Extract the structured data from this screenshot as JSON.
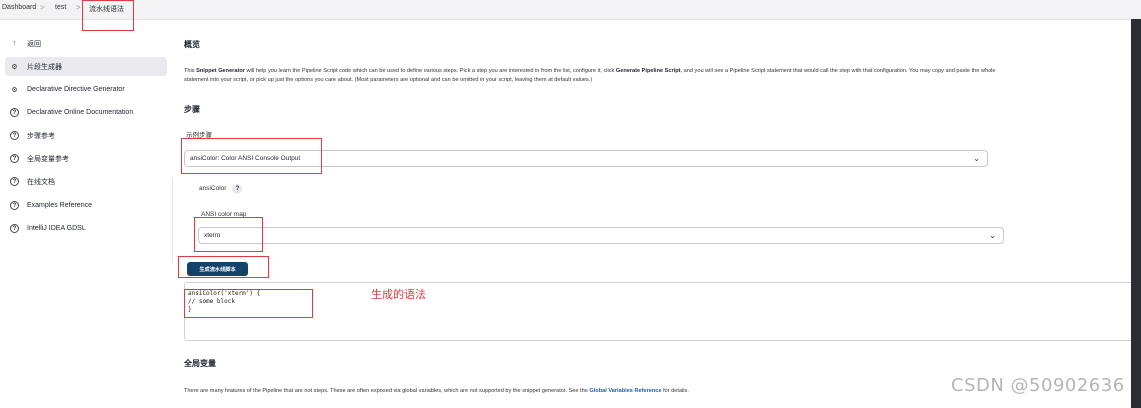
{
  "breadcrumb": {
    "items": [
      "Dashboard",
      "test",
      "流水线语法"
    ],
    "separator": ">"
  },
  "sidebar": {
    "items": [
      {
        "label": "返回",
        "icon": "arrow-up-icon"
      },
      {
        "label": "片段生成器",
        "icon": "gear-icon",
        "active": true
      },
      {
        "label": "Declarative Directive Generator",
        "icon": "gear-icon"
      },
      {
        "label": "Declarative Online Documentation",
        "icon": "help-circle-icon"
      },
      {
        "label": "步骤参考",
        "icon": "help-circle-icon"
      },
      {
        "label": "全局变量参考",
        "icon": "help-circle-icon"
      },
      {
        "label": "在线文档",
        "icon": "help-circle-icon"
      },
      {
        "label": "Examples Reference",
        "icon": "help-circle-icon"
      },
      {
        "label": "IntelliJ IDEA GDSL",
        "icon": "help-circle-icon"
      }
    ]
  },
  "overview": {
    "title": "概览",
    "line1_a": "This ",
    "line1_b": "Snippet Generator",
    "line1_c": " will help you learn the Pipeline Script code which can be used to define various steps. Pick a step you are interested in from the list, configure it, click ",
    "line1_d": "Generate Pipeline Script",
    "line1_e": ", and you will see a Pipeline Script statement that would call the step with that configuration. You may copy and paste the whole",
    "line2": "statement into your script, or pick up just the options you care about. (Most parameters are optional and can be omitted in your script, leaving them at default values.)"
  },
  "steps": {
    "title": "步骤",
    "sample_label": "示例步骤",
    "sample_value": "ansiColor: Color ANSI Console Output",
    "ansicolor_label": "ansiColor",
    "help_label": "?",
    "colormap_label": "ANSI color map",
    "colormap_value": "xterm",
    "generate_button": "生成流水线脚本"
  },
  "code": {
    "lines": [
      "ansiColor('xterm') {",
      "    // some block",
      "}"
    ]
  },
  "annotation": "生成的语法",
  "global_vars": {
    "title": "全局变量",
    "text_a": "There are many features of the Pipeline that are not steps. These are often exposed via global variables, which are not supported by the snippet generator. See the ",
    "link": "Global Variables Reference",
    "text_b": " for details."
  },
  "watermark": "CSDN @50902636",
  "colors": {
    "primary_button": "#13426b",
    "highlight_box": "#e0393e",
    "link": "#1a5fb4"
  }
}
